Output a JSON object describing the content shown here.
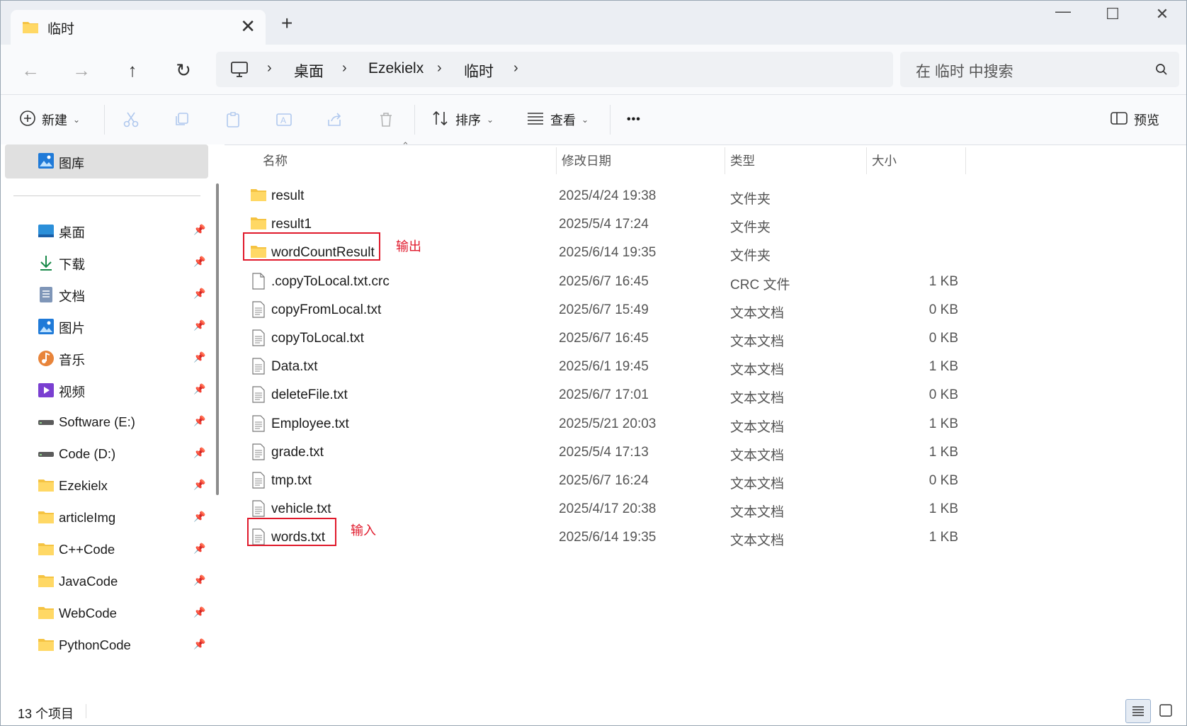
{
  "tab": {
    "title": "临时",
    "close": "✕",
    "new_tab": "+"
  },
  "window_controls": {
    "minimize": "—",
    "maximize": "☐",
    "close": "✕"
  },
  "nav": {
    "back": "←",
    "forward": "→",
    "up": "↑",
    "refresh": "↻"
  },
  "breadcrumb": {
    "items": [
      "桌面",
      "Ezekielx",
      "临时"
    ],
    "sep": "›"
  },
  "search": {
    "placeholder": "在 临时 中搜索"
  },
  "toolbar": {
    "new_label": "新建",
    "sort_label": "排序",
    "view_label": "查看",
    "more": "•••",
    "preview_label": "预览"
  },
  "sidebar": {
    "gallery": "图库",
    "items": [
      {
        "label": "桌面",
        "icon": "desktop-icon"
      },
      {
        "label": "下载",
        "icon": "download-icon"
      },
      {
        "label": "文档",
        "icon": "documents-icon"
      },
      {
        "label": "图片",
        "icon": "pictures-icon"
      },
      {
        "label": "音乐",
        "icon": "music-icon"
      },
      {
        "label": "视频",
        "icon": "videos-icon"
      },
      {
        "label": "Software (E:)",
        "icon": "drive-icon"
      },
      {
        "label": "Code (D:)",
        "icon": "drive-icon"
      },
      {
        "label": "Ezekielx",
        "icon": "folder-icon"
      },
      {
        "label": "articleImg",
        "icon": "folder-icon"
      },
      {
        "label": "C++Code",
        "icon": "folder-icon"
      },
      {
        "label": "JavaCode",
        "icon": "folder-icon"
      },
      {
        "label": "WebCode",
        "icon": "folder-icon"
      },
      {
        "label": "PythonCode",
        "icon": "folder-icon"
      }
    ]
  },
  "columns": {
    "name": "名称",
    "date": "修改日期",
    "type": "类型",
    "size": "大小"
  },
  "files": [
    {
      "name": "result",
      "date": "2025/4/24 19:38",
      "type": "文件夹",
      "size": "",
      "kind": "folder"
    },
    {
      "name": "result1",
      "date": "2025/5/4 17:24",
      "type": "文件夹",
      "size": "",
      "kind": "folder"
    },
    {
      "name": "wordCountResult",
      "date": "2025/6/14 19:35",
      "type": "文件夹",
      "size": "",
      "kind": "folder"
    },
    {
      "name": ".copyToLocal.txt.crc",
      "date": "2025/6/7 16:45",
      "type": "CRC 文件",
      "size": "1 KB",
      "kind": "blank"
    },
    {
      "name": "copyFromLocal.txt",
      "date": "2025/6/7 15:49",
      "type": "文本文档",
      "size": "0 KB",
      "kind": "text"
    },
    {
      "name": "copyToLocal.txt",
      "date": "2025/6/7 16:45",
      "type": "文本文档",
      "size": "0 KB",
      "kind": "text"
    },
    {
      "name": "Data.txt",
      "date": "2025/6/1 19:45",
      "type": "文本文档",
      "size": "1 KB",
      "kind": "text"
    },
    {
      "name": "deleteFile.txt",
      "date": "2025/6/7 17:01",
      "type": "文本文档",
      "size": "0 KB",
      "kind": "text"
    },
    {
      "name": "Employee.txt",
      "date": "2025/5/21 20:03",
      "type": "文本文档",
      "size": "1 KB",
      "kind": "text"
    },
    {
      "name": "grade.txt",
      "date": "2025/5/4 17:13",
      "type": "文本文档",
      "size": "1 KB",
      "kind": "text"
    },
    {
      "name": "tmp.txt",
      "date": "2025/6/7 16:24",
      "type": "文本文档",
      "size": "0 KB",
      "kind": "text"
    },
    {
      "name": "vehicle.txt",
      "date": "2025/4/17 20:38",
      "type": "文本文档",
      "size": "1 KB",
      "kind": "text"
    },
    {
      "name": "words.txt",
      "date": "2025/6/14 19:35",
      "type": "文本文档",
      "size": "1 KB",
      "kind": "text"
    }
  ],
  "annotations": {
    "output": "输出",
    "input": "输入",
    "color": "#e0192b"
  },
  "status": {
    "count": "13 个项目"
  }
}
